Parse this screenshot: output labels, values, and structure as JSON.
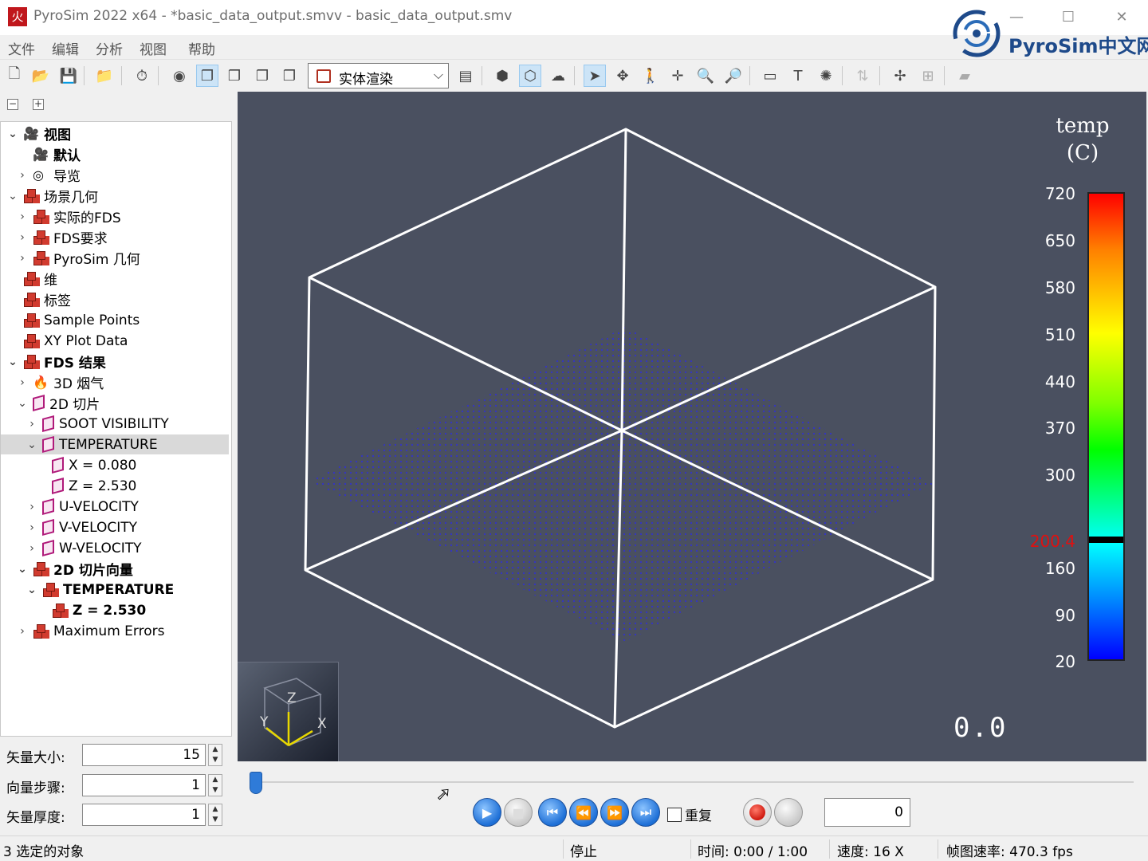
{
  "window": {
    "title": "PyroSim 2022 x64 - *basic_data_output.smvv - basic_data_output.smv",
    "app_icon": "火",
    "logo_text": "PyroSim中文网",
    "minimize": "—",
    "maximize": "☐",
    "close": "✕"
  },
  "menu": [
    "文件",
    "编辑",
    "分析",
    "视图",
    "帮助"
  ],
  "toolbar": {
    "render_mode": "实体渲染"
  },
  "tree": [
    {
      "label": "视图",
      "bold": true,
      "depth": 0,
      "chev": "v",
      "icon": "camera"
    },
    {
      "label": "默认",
      "bold": true,
      "depth": 1,
      "chev": "",
      "icon": "camera"
    },
    {
      "label": "导览",
      "bold": false,
      "depth": 1,
      "chev": ">",
      "icon": "tour"
    },
    {
      "label": "场景几何",
      "bold": false,
      "depth": 0,
      "chev": "v",
      "icon": "red"
    },
    {
      "label": "实际的FDS",
      "bold": false,
      "depth": 1,
      "chev": ">",
      "icon": "red"
    },
    {
      "label": "FDS要求",
      "bold": false,
      "depth": 1,
      "chev": ">",
      "icon": "red"
    },
    {
      "label": "PyroSim 几何",
      "bold": false,
      "depth": 1,
      "chev": ">",
      "icon": "red"
    },
    {
      "label": "维",
      "bold": false,
      "depth": 0,
      "chev": "",
      "icon": "red"
    },
    {
      "label": "标签",
      "bold": false,
      "depth": 0,
      "chev": "",
      "icon": "red"
    },
    {
      "label": "Sample Points",
      "bold": false,
      "depth": 0,
      "chev": "",
      "icon": "red"
    },
    {
      "label": "XY Plot Data",
      "bold": false,
      "depth": 0,
      "chev": "",
      "icon": "red"
    },
    {
      "label": "FDS 结果",
      "bold": true,
      "depth": 0,
      "chev": "v",
      "icon": "red"
    },
    {
      "label": "3D 烟气",
      "bold": false,
      "depth": 1,
      "chev": ">",
      "icon": "smoke"
    },
    {
      "label": "2D 切片",
      "bold": false,
      "depth": 1,
      "chev": "v",
      "icon": "pink"
    },
    {
      "label": "SOOT VISIBILITY",
      "bold": false,
      "depth": 2,
      "chev": ">",
      "icon": "pink"
    },
    {
      "label": "TEMPERATURE",
      "bold": false,
      "depth": 2,
      "chev": "v",
      "icon": "pink",
      "selected": true
    },
    {
      "label": "X = 0.080",
      "bold": false,
      "depth": 3,
      "chev": "",
      "icon": "pink"
    },
    {
      "label": "Z = 2.530",
      "bold": false,
      "depth": 3,
      "chev": "",
      "icon": "pink"
    },
    {
      "label": "U-VELOCITY",
      "bold": false,
      "depth": 2,
      "chev": ">",
      "icon": "pink"
    },
    {
      "label": "V-VELOCITY",
      "bold": false,
      "depth": 2,
      "chev": ">",
      "icon": "pink"
    },
    {
      "label": "W-VELOCITY",
      "bold": false,
      "depth": 2,
      "chev": ">",
      "icon": "pink"
    },
    {
      "label": "2D 切片向量",
      "bold": true,
      "depth": 1,
      "chev": "v",
      "icon": "red"
    },
    {
      "label": "TEMPERATURE",
      "bold": true,
      "depth": 2,
      "chev": "v",
      "icon": "red"
    },
    {
      "label": "Z = 2.530",
      "bold": true,
      "depth": 3,
      "chev": "",
      "icon": "red"
    },
    {
      "label": "Maximum Errors",
      "bold": false,
      "depth": 1,
      "chev": ">",
      "icon": "red"
    }
  ],
  "props": {
    "vector_size": {
      "label": "矢量大小:",
      "value": "15"
    },
    "vector_step": {
      "label": "向量步骤:",
      "value": "1"
    },
    "vector_thickness": {
      "label": "矢量厚度:",
      "value": "1"
    }
  },
  "viewport": {
    "background": "#4a5060",
    "axes": {
      "z": "Z",
      "y": "Y",
      "x": "X"
    },
    "colorbar": {
      "title_line1": "temp",
      "title_line2": "(C)",
      "ticks": [
        "720",
        "650",
        "580",
        "510",
        "440",
        "370",
        "300",
        "200.4",
        "160",
        "90",
        "20"
      ],
      "current_value": "200.4",
      "current_value_color": "#e01010"
    },
    "time_readout": "0.0"
  },
  "playback": {
    "repeat_label": "重复",
    "repeat_checked": false,
    "frame": "0",
    "progress": 0
  },
  "status": {
    "selection": "3 选定的对象",
    "state": "停止",
    "time": "时间:   0:00 / 1:00",
    "speed": "速度:   16 X",
    "fps": "帧图速率:   470.3 fps"
  }
}
